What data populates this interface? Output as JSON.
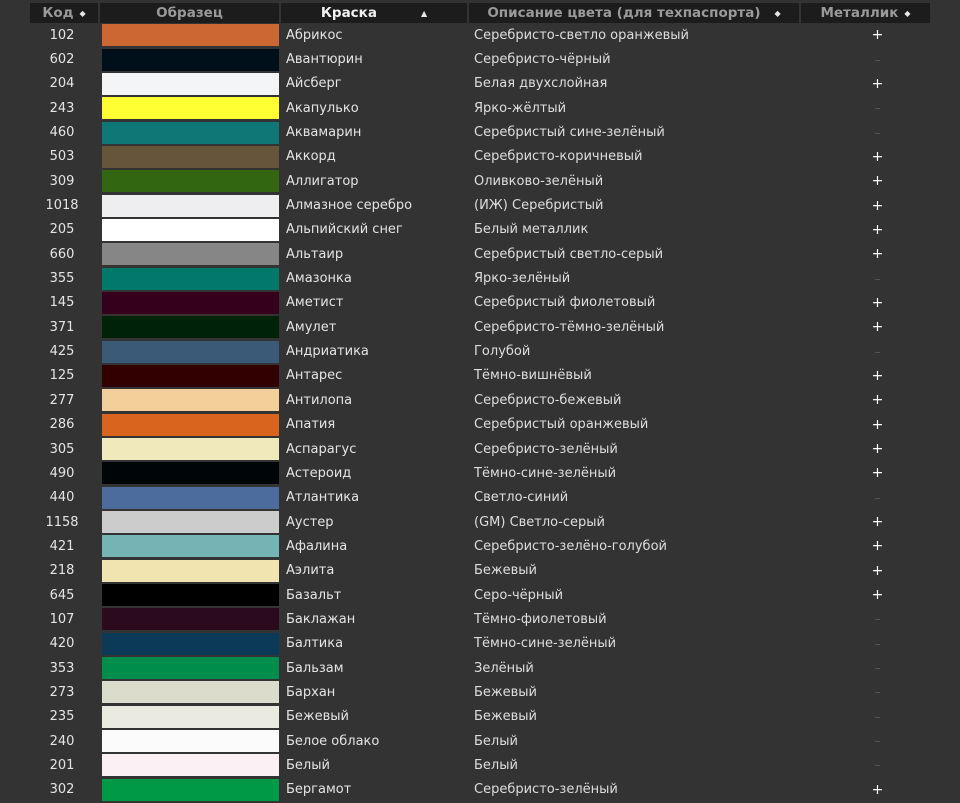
{
  "headers": {
    "code": "Код",
    "swatch": "Образец",
    "paint": "Краска",
    "desc": "Описание цвета (для техпаспорта)",
    "metal": "Металлик"
  },
  "sort_icons": {
    "both": "◆",
    "asc": "▲"
  },
  "rows": [
    {
      "code": "102",
      "color": "#cc6633",
      "paint": "Абрикос",
      "desc": "Серебристо-светло оранжевый",
      "metal": "+"
    },
    {
      "code": "602",
      "color": "#00101a",
      "paint": "Авантюрин",
      "desc": "Серебристо-чёрный",
      "metal": "–"
    },
    {
      "code": "204",
      "color": "#f4f5f7",
      "paint": "Айсберг",
      "desc": "Белая двухслойная",
      "metal": "+"
    },
    {
      "code": "243",
      "color": "#ffff33",
      "paint": "Акапулько",
      "desc": "Ярко-жёлтый",
      "metal": "–"
    },
    {
      "code": "460",
      "color": "#0f7877",
      "paint": "Аквамарин",
      "desc": "Серебристый сине-зелёный",
      "metal": "–"
    },
    {
      "code": "503",
      "color": "#66553a",
      "paint": "Аккорд",
      "desc": "Серебристо-коричневый",
      "metal": "+"
    },
    {
      "code": "309",
      "color": "#336610",
      "paint": "Аллигатор",
      "desc": "Оливково-зелёный",
      "metal": "+"
    },
    {
      "code": "1018",
      "color": "#eeeef0",
      "paint": "Алмазное серебро",
      "desc": "(ИЖ) Серебристый",
      "metal": "+"
    },
    {
      "code": "205",
      "color": "#ffffff",
      "paint": "Альпийский снег",
      "desc": "Белый металлик",
      "metal": "+"
    },
    {
      "code": "660",
      "color": "#868686",
      "paint": "Альтаир",
      "desc": "Серебристый светло-серый",
      "metal": "+"
    },
    {
      "code": "355",
      "color": "#00796b",
      "paint": "Амазонка",
      "desc": "Ярко-зелёный",
      "metal": "–"
    },
    {
      "code": "145",
      "color": "#35001c",
      "paint": "Аметист",
      "desc": "Серебристый фиолетовый",
      "metal": "+"
    },
    {
      "code": "371",
      "color": "#002208",
      "paint": "Амулет",
      "desc": "Серебристо-тёмно-зелёный",
      "metal": "+"
    },
    {
      "code": "425",
      "color": "#3a5a78",
      "paint": "Андриатика",
      "desc": "Голубой",
      "metal": "–"
    },
    {
      "code": "125",
      "color": "#330000",
      "paint": "Антарес",
      "desc": "Тёмно-вишнёвый",
      "metal": "+"
    },
    {
      "code": "277",
      "color": "#f3cf99",
      "paint": "Антилопа",
      "desc": "Серебристо-бежевый",
      "metal": "+"
    },
    {
      "code": "286",
      "color": "#d8641e",
      "paint": "Апатия",
      "desc": "Серебристый оранжевый",
      "metal": "+"
    },
    {
      "code": "305",
      "color": "#efe9bb",
      "paint": "Аспарагус",
      "desc": "Серебристо-зелёный",
      "metal": "+"
    },
    {
      "code": "490",
      "color": "#000508",
      "paint": "Астероид",
      "desc": "Тёмно-сине-зелёный",
      "metal": "+"
    },
    {
      "code": "440",
      "color": "#4b6c9c",
      "paint": "Атлантика",
      "desc": "Светло-синий",
      "metal": "–"
    },
    {
      "code": "1158",
      "color": "#cccccc",
      "paint": "Аустер",
      "desc": "(GM) Светло-серый",
      "metal": "+"
    },
    {
      "code": "421",
      "color": "#74b4b4",
      "paint": "Афалина",
      "desc": "Серебристо-зелёно-голубой",
      "metal": "+"
    },
    {
      "code": "218",
      "color": "#f2e4b0",
      "paint": "Аэлита",
      "desc": "Бежевый",
      "metal": "+"
    },
    {
      "code": "645",
      "color": "#000000",
      "paint": "Базальт",
      "desc": "Серо-чёрный",
      "metal": "+"
    },
    {
      "code": "107",
      "color": "#2c0a1e",
      "paint": "Баклажан",
      "desc": "Тёмно-фиолетовый",
      "metal": "–"
    },
    {
      "code": "420",
      "color": "#0a3a58",
      "paint": "Балтика",
      "desc": "Тёмно-сине-зелёный",
      "metal": "–"
    },
    {
      "code": "353",
      "color": "#008c4a",
      "paint": "Бальзам",
      "desc": "Зелёный",
      "metal": "–"
    },
    {
      "code": "273",
      "color": "#dcdccc",
      "paint": "Бархан",
      "desc": "Бежевый",
      "metal": "–"
    },
    {
      "code": "235",
      "color": "#eaeae0",
      "paint": "Бежевый",
      "desc": "Бежевый",
      "metal": "–"
    },
    {
      "code": "240",
      "color": "#fbfbfb",
      "paint": "Белое облако",
      "desc": "Белый",
      "metal": "–"
    },
    {
      "code": "201",
      "color": "#fbf0f4",
      "paint": "Белый",
      "desc": "Белый",
      "metal": "–"
    },
    {
      "code": "302",
      "color": "#009946",
      "paint": "Бергамот",
      "desc": "Серебристо-зелёный",
      "metal": "+"
    }
  ]
}
